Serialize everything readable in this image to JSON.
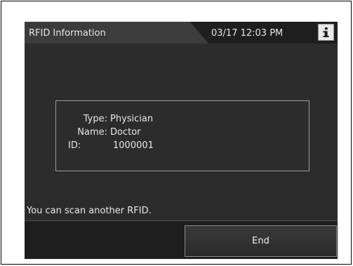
{
  "header": {
    "title": "RFID Information",
    "datetime": "03/17 12:03 PM",
    "info_icon": "info-icon"
  },
  "rfid": {
    "type_label": "Type:",
    "type_value": "Physician",
    "name_label": "Name:",
    "name_value": "Doctor",
    "id_label": "ID:",
    "id_value": "1000001"
  },
  "message": "You can scan another RFID.",
  "footer": {
    "end_label": "End"
  },
  "colors": {
    "screen_bg": "#2c2c2c",
    "header_bg": "#1e1e1e",
    "text": "#e6e6e6",
    "info_button_bg": "#e8e8e8"
  }
}
